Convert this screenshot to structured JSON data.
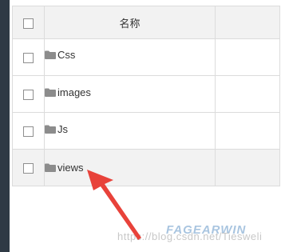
{
  "table": {
    "header": {
      "name_label": "名称"
    },
    "rows": [
      {
        "name": "Css"
      },
      {
        "name": "images"
      },
      {
        "name": "Js"
      },
      {
        "name": "views"
      }
    ]
  },
  "watermark": {
    "text": "https://blog.csdn.net/Tiesweli",
    "logo_text": "FAGEARWIN"
  },
  "colors": {
    "sidebar": "#2f3a45",
    "header_bg": "#f2f2f2",
    "border": "#dcdcdc",
    "folder_icon": "#8c8c8c",
    "arrow": "#e8423a"
  },
  "icons": {
    "folder": "folder-icon",
    "checkbox": "checkbox-icon",
    "annotation": "red-arrow"
  }
}
